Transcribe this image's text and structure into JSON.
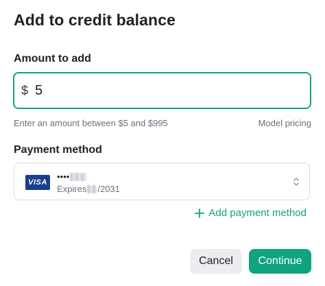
{
  "dialog": {
    "title": "Add to credit balance"
  },
  "amount": {
    "label": "Amount to add",
    "currency": "$",
    "value": "5",
    "hint": "Enter an amount between $5 and $995",
    "pricing_link": "Model pricing"
  },
  "payment": {
    "label": "Payment method",
    "card_brand": "VISA",
    "card_masked": "••••",
    "expiry_prefix": "Expires",
    "expiry_suffix": "/2031",
    "add_label": "Add payment method"
  },
  "actions": {
    "cancel_label": "Cancel",
    "continue_label": "Continue"
  },
  "colors": {
    "accent": "#10a37f",
    "visa": "#1a3f8c"
  }
}
